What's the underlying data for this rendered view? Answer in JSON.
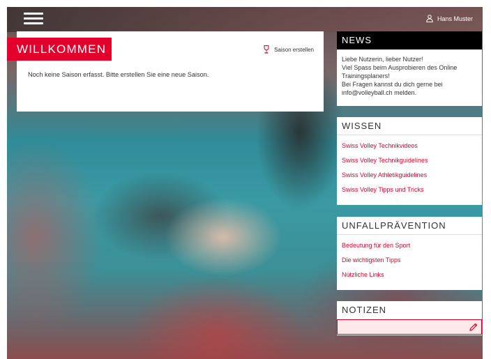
{
  "header": {
    "menu_icon": "hamburger-icon",
    "user_icon": "user-icon",
    "user_name": "Hans Muster"
  },
  "welcome": {
    "title": "WILLKOMMEN",
    "season_button_icon": "trophy-icon",
    "season_button_label": "Saison erstellen",
    "message": "Noch keine Saison erfasst. Bitte erstellen Sie eine neue Saison."
  },
  "news": {
    "title": "NEWS",
    "lines": [
      "Liebe Nutzerin, lieber Nutzer!",
      "Viel Spass beim Ausprobieren des Online",
      "Trainingsplaners!",
      "Bei Fragen kannst du dich gerne bei",
      "info@volleyball.ch melden."
    ]
  },
  "wissen": {
    "title": "WISSEN",
    "links": [
      "Swiss Volley Technikvideos",
      "Swiss Volley Technikguidelines",
      "Swiss Volley Athletikguidelines",
      "Swiss Volley Tipps und Tricks"
    ]
  },
  "unfall": {
    "title": "UNFALLPRÄVENTION",
    "links": [
      "Bedeutung für den Sport",
      "Die wichtigsten Tipps",
      "Nützliche Links"
    ]
  },
  "notizen": {
    "title": "NOTIZEN",
    "value": "",
    "edit_icon": "pencil-icon"
  },
  "colors": {
    "accent": "#e4002b",
    "news_header": "#000000",
    "note_field_bg": "#fde9ea"
  }
}
